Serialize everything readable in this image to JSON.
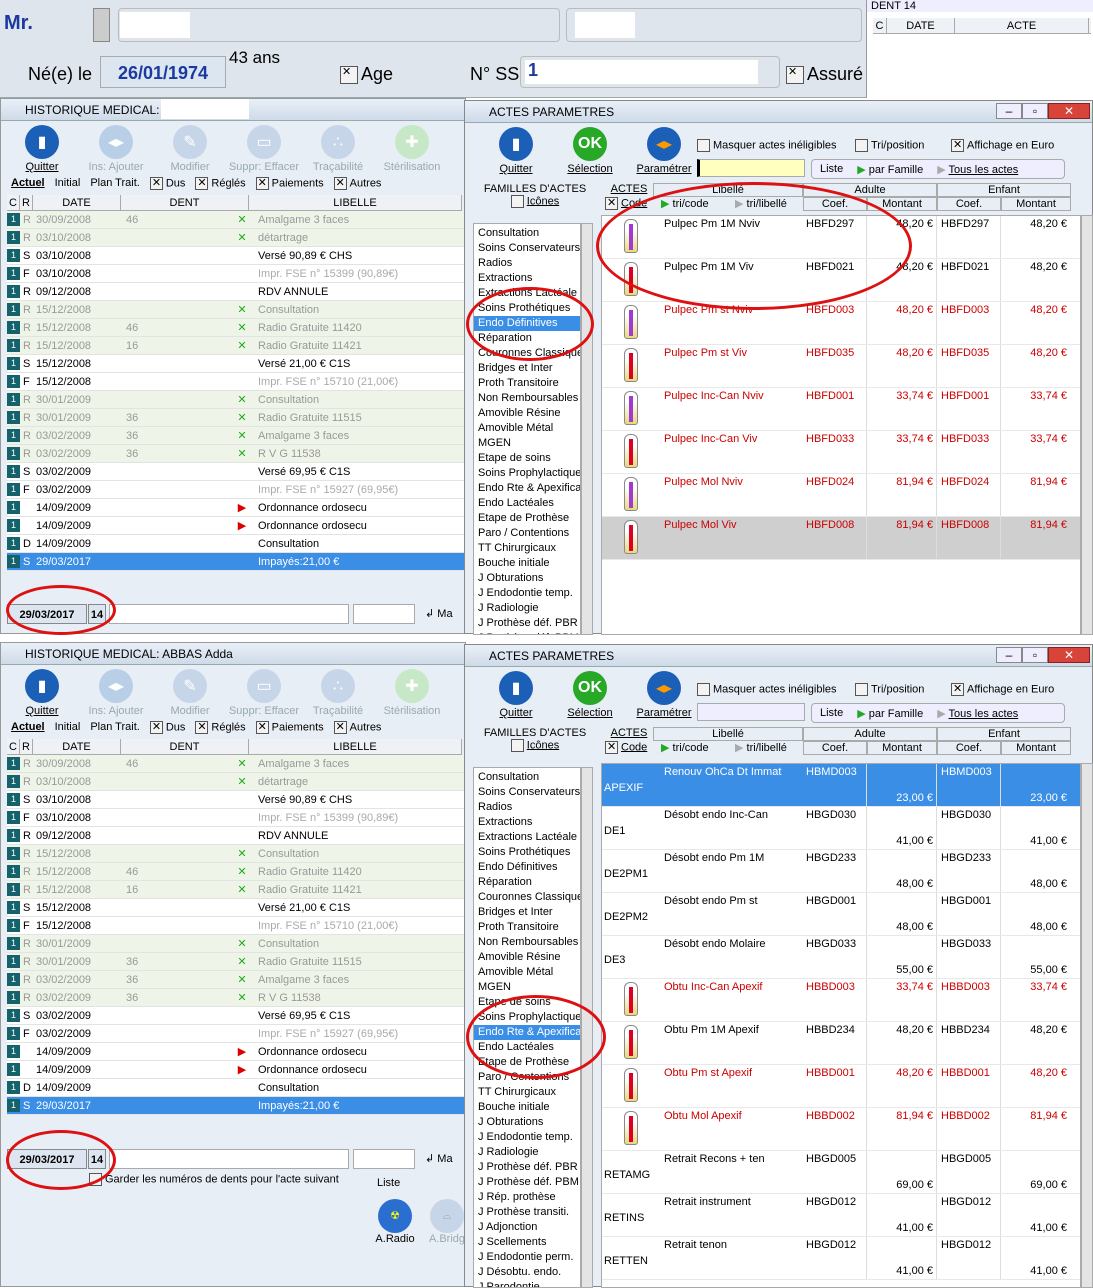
{
  "header": {
    "civility": "Mr.",
    "born_label": "Né(e) le",
    "birth_date": "26/01/1974",
    "age": "43 ans",
    "age_label": "Age",
    "ss_label": "N° SS",
    "ss_value": "1",
    "assure_label": "Assuré"
  },
  "dent_box": {
    "title": "DENT 14",
    "cols": [
      "C",
      "DATE",
      "ACTE"
    ]
  },
  "hist": {
    "title_top": "HISTORIQUE MEDICAL:",
    "title_bottom": "HISTORIQUE MEDICAL: ABBAS Adda",
    "toolbar": [
      "Quitter",
      "Ins: Ajouter",
      "Modifier",
      "Suppr: Effacer",
      "Traçabilité",
      "Stérilisation"
    ],
    "tabs": [
      "Actuel",
      "Initial",
      "Plan Trait.",
      "Dus",
      "Réglés",
      "Paiements",
      "Autres"
    ],
    "cols": [
      "C",
      "R",
      "DATE",
      "DENT",
      "LIBELLE"
    ],
    "rows": [
      {
        "c": "1",
        "r": "R",
        "date": "30/09/2008",
        "dent": "46",
        "ok": "✕",
        "lib": "Amalgame 3 faces",
        "g": true
      },
      {
        "c": "1",
        "r": "R",
        "date": "03/10/2008",
        "dent": "",
        "ok": "✕",
        "lib": "détartrage",
        "g": true
      },
      {
        "c": "1",
        "r": "S",
        "date": "03/10/2008",
        "dent": "",
        "ok": "",
        "lib": "Versé 90,89 € CHS",
        "g": false
      },
      {
        "c": "1",
        "r": "F",
        "date": "03/10/2008",
        "dent": "",
        "ok": "",
        "lib": "Impr. FSE n° 15399 (90,89€)",
        "g": false,
        "dim": true
      },
      {
        "c": "1",
        "r": "R",
        "date": "09/12/2008",
        "dent": "",
        "ok": "",
        "lib": "RDV ANNULE",
        "g": false
      },
      {
        "c": "1",
        "r": "R",
        "date": "15/12/2008",
        "dent": "",
        "ok": "✕",
        "lib": "Consultation",
        "g": true
      },
      {
        "c": "1",
        "r": "R",
        "date": "15/12/2008",
        "dent": "46",
        "ok": "✕",
        "lib": "Radio Gratuite 11420",
        "g": true
      },
      {
        "c": "1",
        "r": "R",
        "date": "15/12/2008",
        "dent": "16",
        "ok": "✕",
        "lib": "Radio Gratuite 11421",
        "g": true
      },
      {
        "c": "1",
        "r": "S",
        "date": "15/12/2008",
        "dent": "",
        "ok": "",
        "lib": "Versé 21,00 € C1S",
        "g": false
      },
      {
        "c": "1",
        "r": "F",
        "date": "15/12/2008",
        "dent": "",
        "ok": "",
        "lib": "Impr. FSE n° 15710 (21,00€)",
        "g": false,
        "dim": true
      },
      {
        "c": "1",
        "r": "R",
        "date": "30/01/2009",
        "dent": "",
        "ok": "✕",
        "lib": "Consultation",
        "g": true
      },
      {
        "c": "1",
        "r": "R",
        "date": "30/01/2009",
        "dent": "36",
        "ok": "✕",
        "lib": "Radio Gratuite 11515",
        "g": true
      },
      {
        "c": "1",
        "r": "R",
        "date": "03/02/2009",
        "dent": "36",
        "ok": "✕",
        "lib": "Amalgame 3 faces",
        "g": true
      },
      {
        "c": "1",
        "r": "R",
        "date": "03/02/2009",
        "dent": "36",
        "ok": "✕",
        "lib": "R V G          11538",
        "g": true
      },
      {
        "c": "1",
        "r": "S",
        "date": "03/02/2009",
        "dent": "",
        "ok": "",
        "lib": "Versé 69,95 € C1S",
        "g": false
      },
      {
        "c": "1",
        "r": "F",
        "date": "03/02/2009",
        "dent": "",
        "ok": "",
        "lib": "Impr. FSE n° 15927 (69,95€)",
        "g": false,
        "dim": true
      },
      {
        "c": "1",
        "r": "",
        "date": "14/09/2009",
        "dent": "",
        "ok": "▶",
        "lib": "Ordonnance ordosecu",
        "g": false
      },
      {
        "c": "1",
        "r": "",
        "date": "14/09/2009",
        "dent": "",
        "ok": "▶",
        "lib": "Ordonnance ordosecu",
        "g": false
      },
      {
        "c": "1",
        "r": "D",
        "date": "14/09/2009",
        "dent": "",
        "ok": "",
        "lib": "Consultation",
        "g": false
      },
      {
        "c": "1",
        "r": "S",
        "date": "29/03/2017",
        "dent": "",
        "ok": "",
        "lib": "Impayés:21,00 €",
        "g": false,
        "sel": true
      }
    ],
    "footer_date": "29/03/2017",
    "footer_tooth": "14",
    "keep_label": "Garder les numéros de dents pour l'acte suivant",
    "liste_label": "Liste",
    "aradio": "A.Radio",
    "abridge": "A.Bridg",
    "ma": "Ma"
  },
  "actes": {
    "title": "ACTES PARAMETRES",
    "toolbar": [
      "Quitter",
      "Sélection",
      "Paramétrer"
    ],
    "opts": [
      "Masquer actes inéligibles",
      "Tri/position",
      "Affichage en Euro"
    ],
    "liste": "Liste",
    "par_famille": "par Famille",
    "tous": "Tous les actes",
    "fam_header": "FAMILLES D'ACTES",
    "icones": "Icônes",
    "actes_label": "ACTES",
    "code": "Code",
    "tri_code": "tri/code",
    "tri_lib": "tri/libellé",
    "libelle": "Libellé",
    "adulte": "Adulte",
    "enfant": "Enfant",
    "coef": "Coef.",
    "montant": "Montant",
    "families_top": [
      "Consultation",
      "Soins Conservateurs",
      "Radios",
      "Extractions",
      "Extractions Lactéale",
      "Soins Prothétiques",
      "Endo Définitives",
      "Réparation",
      "Couronnes Classique",
      "Bridges et Inter",
      "Proth Transitoire",
      "Non Remboursables",
      "Amovible Résine",
      "Amovible Métal",
      "MGEN",
      "Etape de soins",
      "Soins Prophylactique",
      "Endo Rte & Apexifica",
      "Endo Lactéales",
      "Etape de Prothèse",
      "Paro / Contentions",
      "TT Chirurgicaux",
      "Bouche initiale",
      "J  Obturations",
      "J  Endodontie temp.",
      "J  Radiologie",
      "J  Prothèse déf. PBR",
      "J  Prothèse déf. PBM"
    ],
    "families_bottom": [
      "Consultation",
      "Soins Conservateurs",
      "Radios",
      "Extractions",
      "Extractions Lactéale",
      "Soins Prothétiques",
      "Endo Définitives",
      "Réparation",
      "Couronnes Classique",
      "Bridges et Inter",
      "Proth Transitoire",
      "Non Remboursables",
      "Amovible Résine",
      "Amovible Métal",
      "MGEN",
      "Etape de soins",
      "Soins Prophylactique",
      "Endo Rte & Apexifica",
      "Endo Lactéales",
      "Etape de Prothèse",
      "Paro / Contentions",
      "TT Chirurgicaux",
      "Bouche initiale",
      "J  Obturations",
      "J  Endodontie temp.",
      "J  Radiologie",
      "J  Prothèse déf. PBR",
      "J  Prothèse déf. PBM",
      "J  Rép. prothèse",
      "J  Prothèse transiti.",
      "J  Adjonction",
      "J  Scellements",
      "J  Endodontie perm.",
      "J  Désobtu. endo.",
      "J  Parodontie"
    ],
    "rows_top": [
      {
        "code": "",
        "lib": "Pulpec  Pm 1M  Nviv",
        "acode": "HBFD297",
        "am": "48,20 €",
        "ecode": "HBFD297",
        "em": "48,20 €",
        "red": false,
        "t": "vio"
      },
      {
        "code": "",
        "lib": "Pulpec  Pm 1M  Viv",
        "acode": "HBFD021",
        "am": "48,20 €",
        "ecode": "HBFD021",
        "em": "48,20 €",
        "red": false,
        "t": "red"
      },
      {
        "code": "",
        "lib": "Pulpec  Pm st Nviv",
        "acode": "HBFD003",
        "am": "48,20 €",
        "ecode": "HBFD003",
        "em": "48,20 €",
        "red": true,
        "t": "vio"
      },
      {
        "code": "",
        "lib": "Pulpec  Pm st  Viv",
        "acode": "HBFD035",
        "am": "48,20 €",
        "ecode": "HBFD035",
        "em": "48,20 €",
        "red": true,
        "t": "red"
      },
      {
        "code": "",
        "lib": "Pulpec  Inc-Can Nviv",
        "acode": "HBFD001",
        "am": "33,74 €",
        "ecode": "HBFD001",
        "em": "33,74 €",
        "red": true,
        "t": "vio"
      },
      {
        "code": "",
        "lib": "Pulpec  Inc-Can  Viv",
        "acode": "HBFD033",
        "am": "33,74 €",
        "ecode": "HBFD033",
        "em": "33,74 €",
        "red": true,
        "t": "red"
      },
      {
        "code": "",
        "lib": "Pulpec Mol Nviv",
        "acode": "HBFD024",
        "am": "81,94 €",
        "ecode": "HBFD024",
        "em": "81,94 €",
        "red": true,
        "t": "vio"
      },
      {
        "code": "",
        "lib": "Pulpec Mol  Viv",
        "acode": "HBFD008",
        "am": "81,94 €",
        "ecode": "HBFD008",
        "em": "81,94 €",
        "red": true,
        "t": "red",
        "gray": true
      }
    ],
    "rows_bottom": [
      {
        "code": "APEXIF",
        "lib": "Renouv OhCa Dt Immat",
        "acode": "HBMD003",
        "am": "23,00 €",
        "ecode": "HBMD003",
        "em": "23,00 €",
        "blue": true
      },
      {
        "code": "DE1",
        "lib": "Désobt endo  Inc-Can",
        "acode": "HBGD030",
        "am": "41,00 €",
        "ecode": "HBGD030",
        "em": "41,00 €"
      },
      {
        "code": "DE2PM1",
        "lib": "Désobt endo  Pm 1M",
        "acode": "HBGD233",
        "am": "48,00 €",
        "ecode": "HBGD233",
        "em": "48,00 €"
      },
      {
        "code": "DE2PM2",
        "lib": "Désobt endo  Pm st",
        "acode": "HBGD001",
        "am": "48,00 €",
        "ecode": "HBGD001",
        "em": "48,00 €"
      },
      {
        "code": "DE3",
        "lib": "Désobt endo Molaire",
        "acode": "HBGD033",
        "am": "55,00 €",
        "ecode": "HBGD033",
        "em": "55,00 €"
      },
      {
        "code": "",
        "lib": "Obtu  Inc-Can Apexif",
        "acode": "HBBD003",
        "am": "33,74 €",
        "ecode": "HBBD003",
        "em": "33,74 €",
        "red": true,
        "t": "red"
      },
      {
        "code": "",
        "lib": "Obtu  Pm 1M Apexif",
        "acode": "HBBD234",
        "am": "48,20 €",
        "ecode": "HBBD234",
        "em": "48,20 €",
        "t": "red"
      },
      {
        "code": "",
        "lib": "Obtu  Pm st Apexif",
        "acode": "HBBD001",
        "am": "48,20 €",
        "ecode": "HBBD001",
        "em": "48,20 €",
        "red": true,
        "t": "red"
      },
      {
        "code": "",
        "lib": "Obtu Mol Apexif",
        "acode": "HBBD002",
        "am": "81,94 €",
        "ecode": "HBBD002",
        "em": "81,94 €",
        "red": true,
        "t": "red"
      },
      {
        "code": "RETAMG",
        "lib": "Retrait Recons + ten",
        "acode": "HBGD005",
        "am": "69,00 €",
        "ecode": "HBGD005",
        "em": "69,00 €"
      },
      {
        "code": "RETINS",
        "lib": "Retrait instrument",
        "acode": "HBGD012",
        "am": "41,00 €",
        "ecode": "HBGD012",
        "em": "41,00 €"
      },
      {
        "code": "RETTEN",
        "lib": "Retrait tenon",
        "acode": "HBGD012",
        "am": "41,00 €",
        "ecode": "HBGD012",
        "em": "41,00 €"
      }
    ]
  }
}
